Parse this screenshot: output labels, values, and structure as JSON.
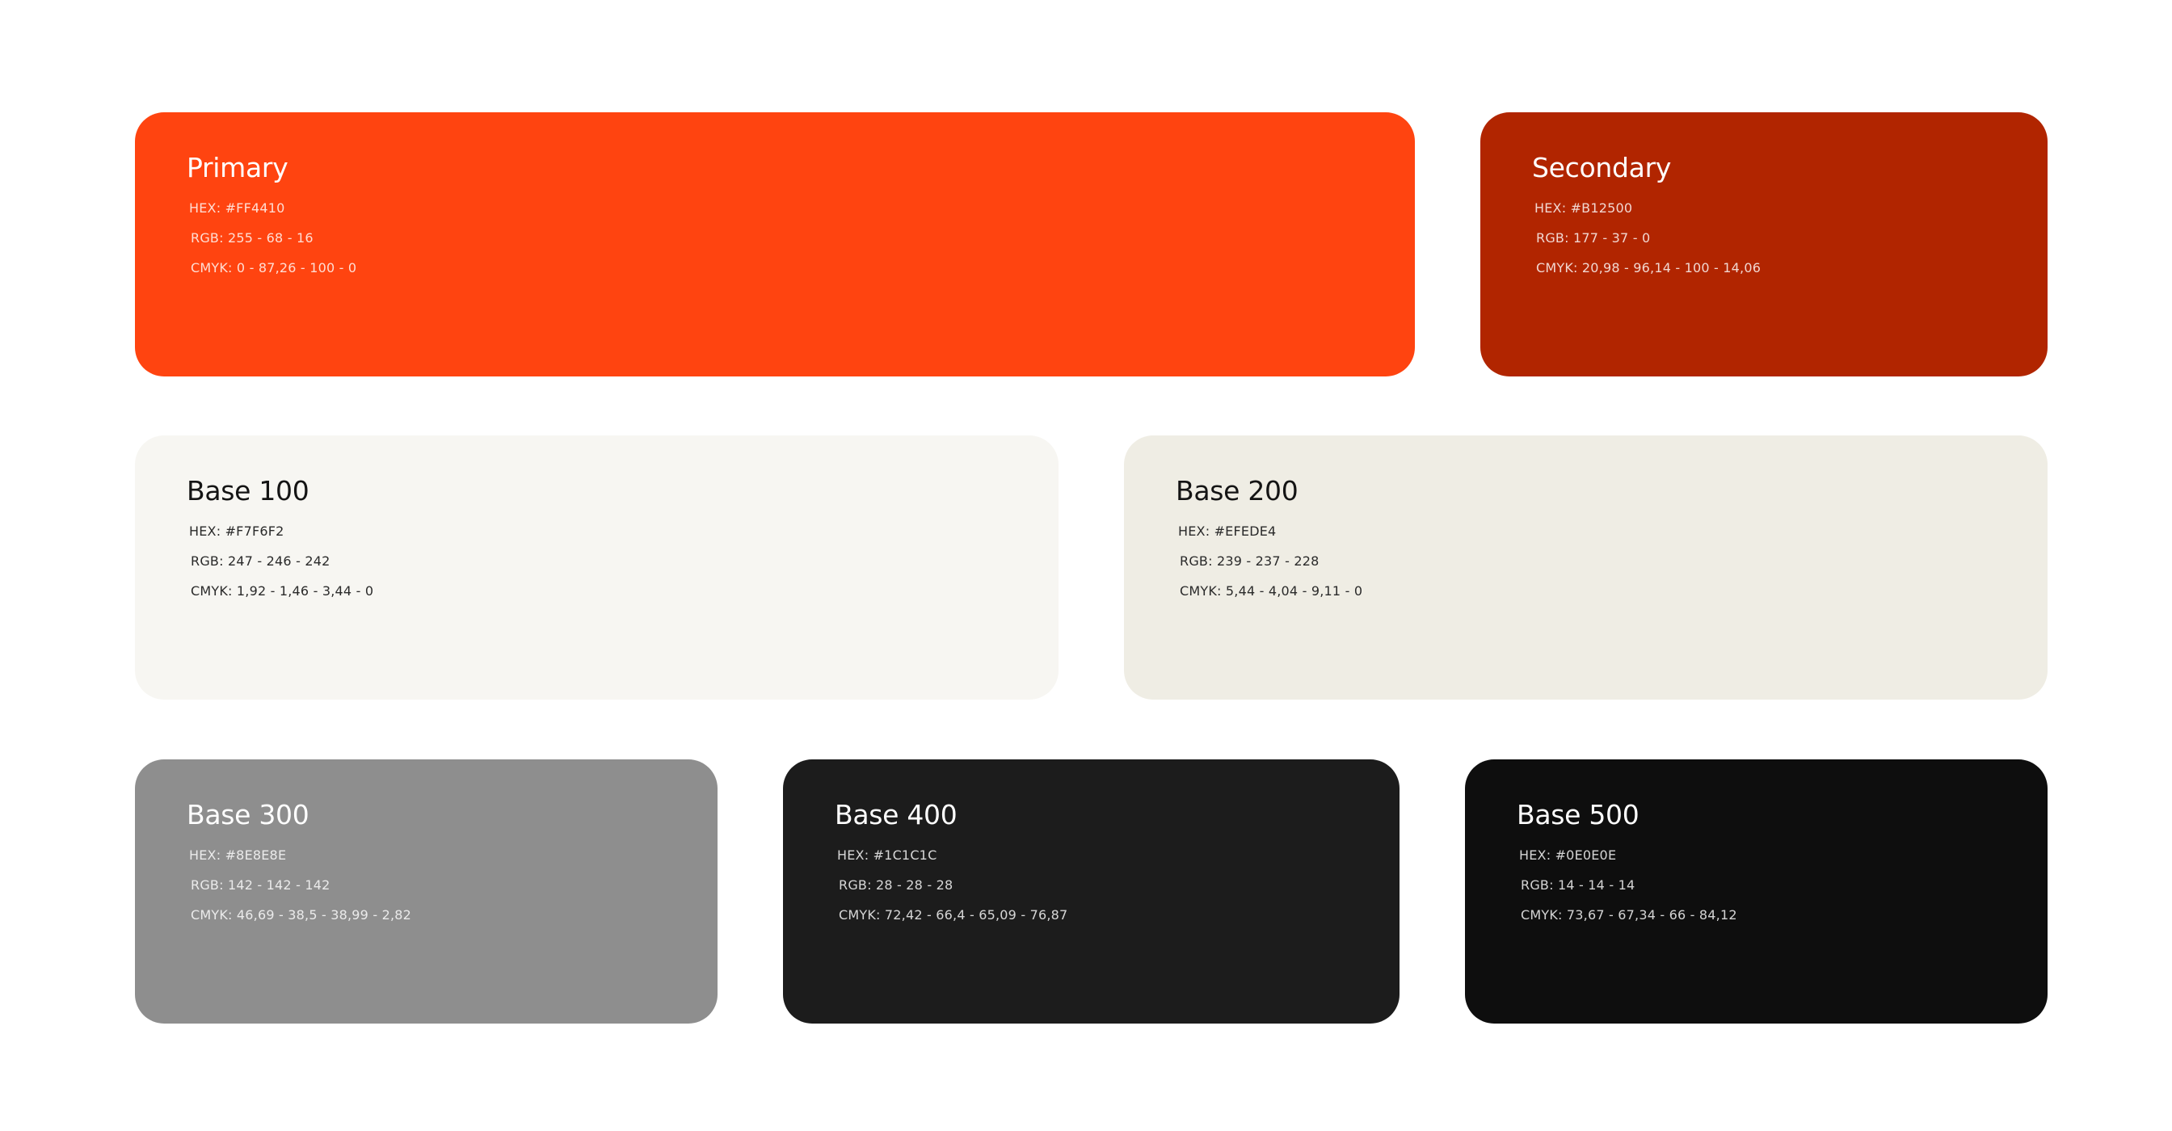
{
  "swatches": [
    {
      "name": "Primary",
      "hex": "HEX: #FF4410",
      "rgb": "RGB: 255 - 68 - 16",
      "cmyk": "CMYK: 0 - 87,26 - 100 - 0",
      "color": "#FF4410"
    },
    {
      "name": "Secondary",
      "hex": "HEX: #B12500",
      "rgb": "RGB: 177 - 37 - 0",
      "cmyk": "CMYK: 20,98 - 96,14 - 100 - 14,06",
      "color": "#B12500"
    },
    {
      "name": "Base 100",
      "hex": "HEX: #F7F6F2",
      "rgb": "RGB: 247 - 246 - 242",
      "cmyk": "CMYK: 1,92 - 1,46 - 3,44 - 0",
      "color": "#F7F6F2"
    },
    {
      "name": "Base 200",
      "hex": "HEX: #EFEDE4",
      "rgb": "RGB: 239 - 237 - 228",
      "cmyk": "CMYK: 5,44 - 4,04 - 9,11 - 0",
      "color": "#EFEDE4"
    },
    {
      "name": "Base 300",
      "hex": "HEX: #8E8E8E",
      "rgb": "RGB: 142 - 142 - 142",
      "cmyk": "CMYK: 46,69 - 38,5 - 38,99 - 2,82",
      "color": "#8E8E8E"
    },
    {
      "name": "Base 400",
      "hex": "HEX: #1C1C1C",
      "rgb": "RGB: 28 - 28 - 28",
      "cmyk": "CMYK: 72,42 - 66,4 - 65,09 - 76,87",
      "color": "#1C1C1C"
    },
    {
      "name": "Base 500",
      "hex": "HEX: #0E0E0E",
      "rgb": "RGB: 14 - 14 - 14",
      "cmyk": "CMYK: 73,67 - 67,34 - 66 - 84,12",
      "color": "#0E0E0E"
    }
  ]
}
